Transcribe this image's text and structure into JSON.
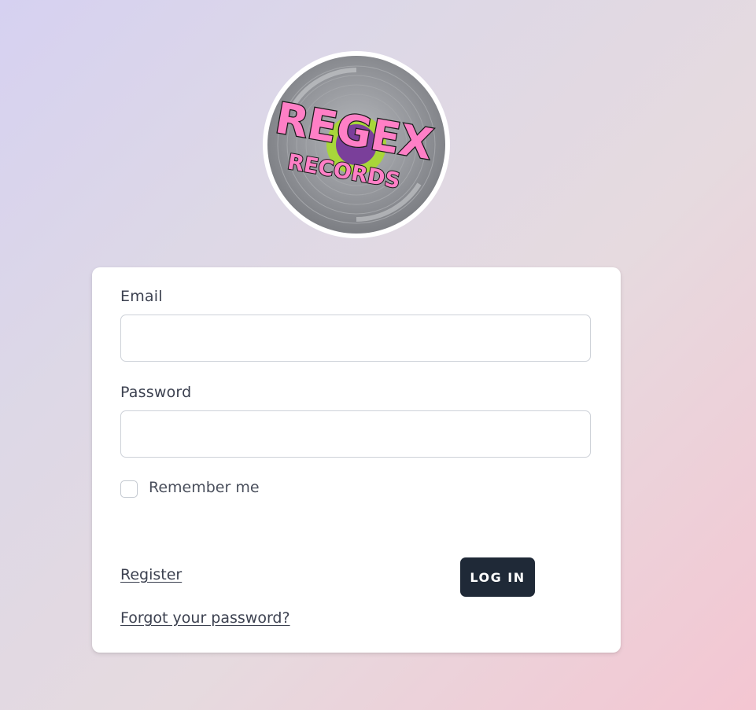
{
  "logo": {
    "line1": "REGEX",
    "line2": "RECORDS",
    "colors": {
      "ring": "#ffffff",
      "vinyl": "#8e9095",
      "label_green": "#a8d63a",
      "label_purple": "#7a3f9a",
      "text_pink": "#ff7fc6",
      "text_outline": "#1a1a1a"
    }
  },
  "form": {
    "email_label": "Email",
    "email_value": "",
    "password_label": "Password",
    "password_value": "",
    "remember_label": "Remember me",
    "remember_checked": false,
    "register_link": "Register",
    "forgot_link": "Forgot your password?",
    "login_button": "LOG IN"
  },
  "theme": {
    "button_bg": "#1f2937",
    "text": "#3c4150"
  }
}
